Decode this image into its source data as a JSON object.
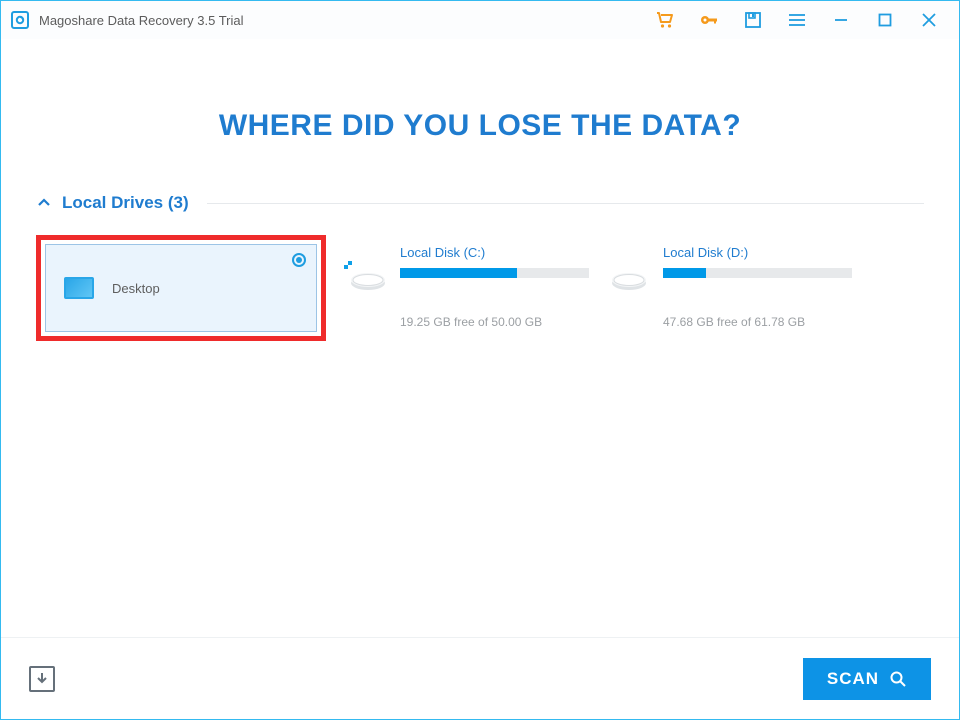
{
  "titlebar": {
    "title": "Magoshare Data Recovery 3.5 Trial"
  },
  "headline": "WHERE DID YOU LOSE THE DATA?",
  "section": {
    "label": "Local Drives (3)"
  },
  "drives": {
    "desktop": {
      "name": "Desktop",
      "selected": true
    },
    "c": {
      "name": "Local Disk (C:)",
      "free_text": "19.25 GB free of 50.00 GB",
      "used_pct": 62
    },
    "d": {
      "name": "Local Disk (D:)",
      "free_text": "47.68 GB free of 61.78 GB",
      "used_pct": 23
    }
  },
  "scan_label": "SCAN"
}
